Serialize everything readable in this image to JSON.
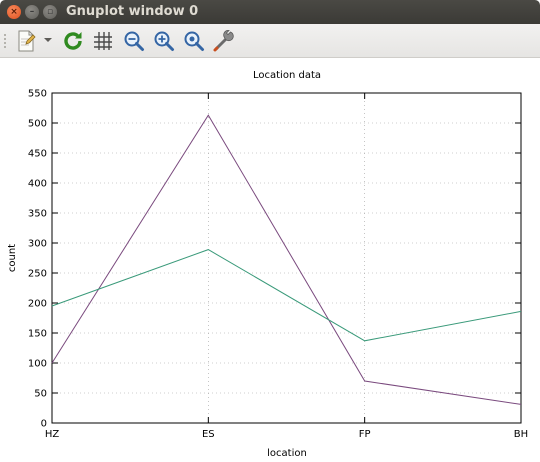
{
  "window": {
    "title": "Gnuplot window 0",
    "close_glyph": "×",
    "min_glyph": "–",
    "max_glyph": "▫"
  },
  "toolbar": {
    "items": [
      "copy-icon",
      "dropdown-arrow-icon",
      "replot-icon",
      "grid-icon",
      "zoom-out-icon",
      "zoom-in-icon",
      "zoom-fit-icon",
      "config-icon"
    ]
  },
  "chart_data": {
    "type": "line",
    "title": "Location data",
    "xlabel": "location",
    "ylabel": "count",
    "categories": [
      "HZ",
      "ES",
      "FP",
      "BH"
    ],
    "ylim": [
      0,
      550
    ],
    "yticks": [
      0,
      50,
      100,
      150,
      200,
      250,
      300,
      350,
      400,
      450,
      500,
      550
    ],
    "grid": true,
    "series": [
      {
        "values": [
          100,
          513,
          70,
          31
        ],
        "color": "#7a4a7e"
      },
      {
        "values": [
          195,
          289,
          137,
          186
        ],
        "color": "#3a9a7a"
      }
    ]
  }
}
